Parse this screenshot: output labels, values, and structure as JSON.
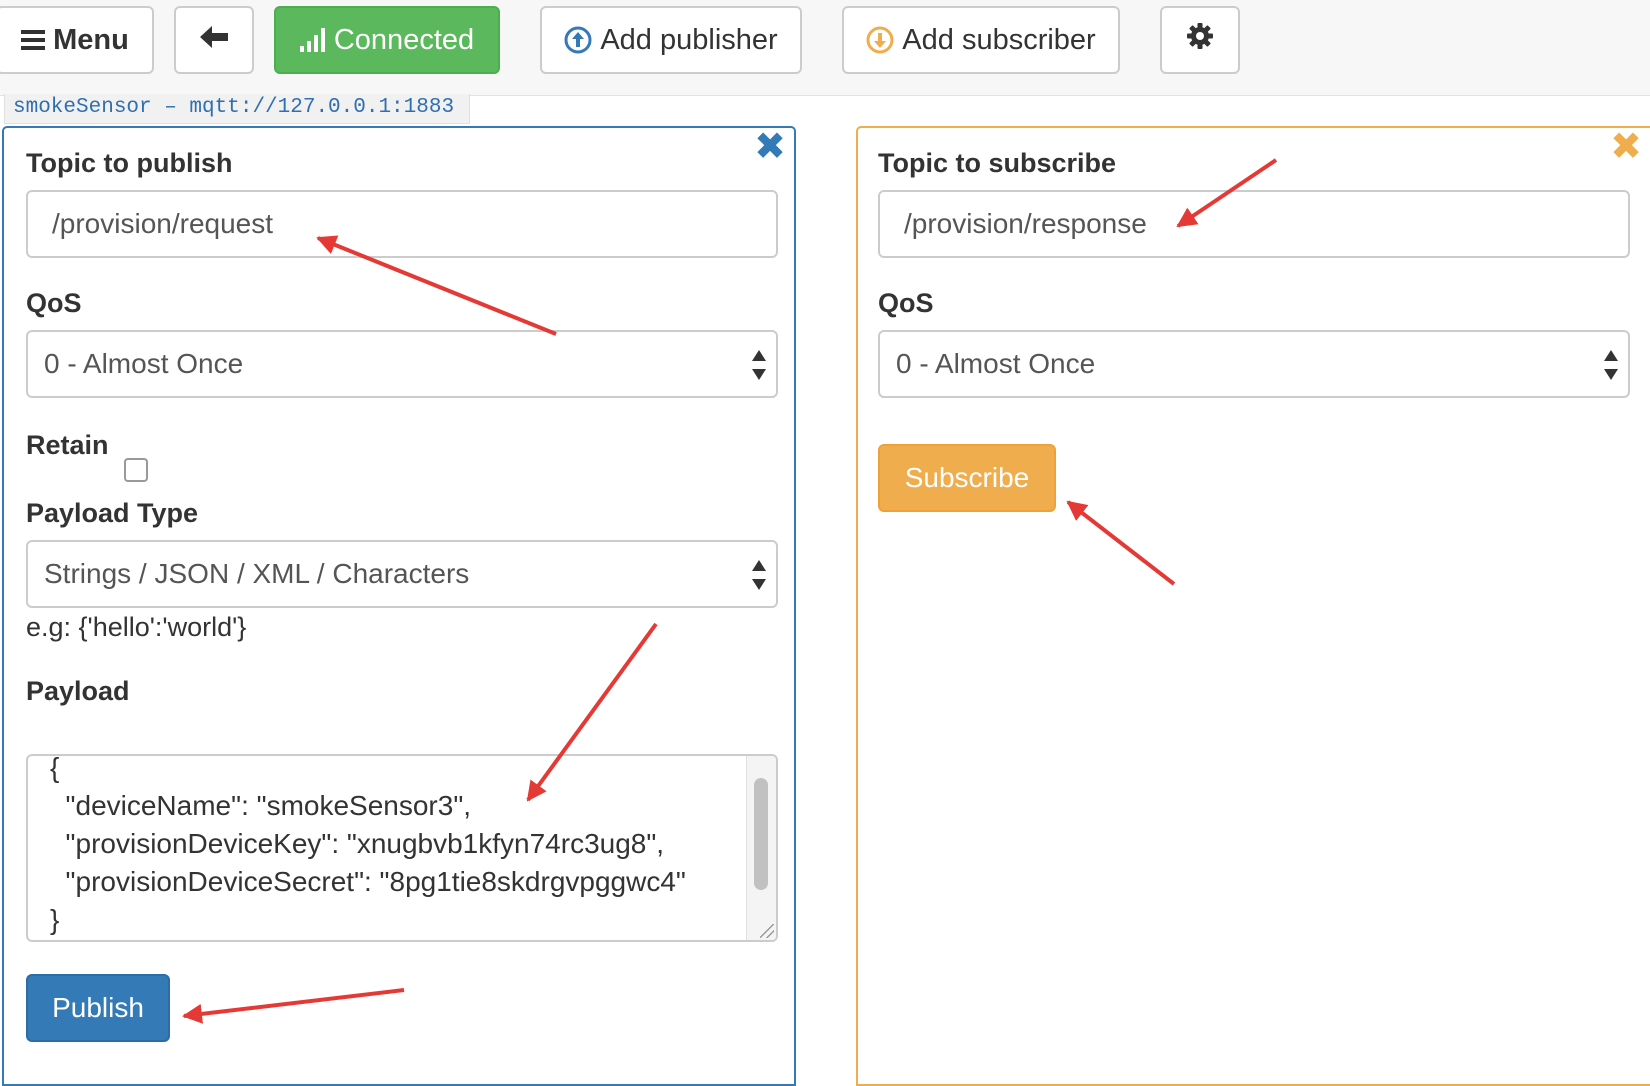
{
  "toolbar": {
    "menu_label": "Menu",
    "connected_label": "Connected",
    "add_publisher_label": "Add publisher",
    "add_subscriber_label": "Add subscriber",
    "icons": {
      "menu": "hamburger-icon",
      "back": "arrow-left-icon",
      "connected": "signal-bars-icon",
      "add_publisher": "circle-arrow-up-icon",
      "add_subscriber": "circle-arrow-down-icon",
      "settings": "gear-icon"
    }
  },
  "connection": {
    "label": "smokeSensor – mqtt://127.0.0.1:1883"
  },
  "publisher": {
    "topic_label": "Topic to publish",
    "topic_value": "/provision/request",
    "qos_label": "QoS",
    "qos_value": "0 - Almost Once",
    "retain_label": "Retain",
    "retain_checked": false,
    "payload_type_label": "Payload Type",
    "payload_type_value": "Strings / JSON / XML / Characters",
    "payload_hint": "e.g: {'hello':'world'}",
    "payload_label": "Payload",
    "payload_lines": [
      "{",
      "  \"deviceName\": \"smokeSensor3\",",
      "  \"provisionDeviceKey\": \"xnugbvb1kfyn74rc3ug8\",",
      "  \"provisionDeviceSecret\": \"8pg1tie8skdrgvpggwc4\"",
      "}"
    ],
    "publish_label": "Publish"
  },
  "subscriber": {
    "topic_label": "Topic to subscribe",
    "topic_value": "/provision/response",
    "qos_label": "QoS",
    "qos_value": "0 - Almost Once",
    "subscribe_label": "Subscribe"
  },
  "colors": {
    "connected": "#5cb85c",
    "publisher_accent": "#337ab7",
    "subscriber_accent": "#f0ad4e",
    "annotation_arrow": "#e53935"
  }
}
